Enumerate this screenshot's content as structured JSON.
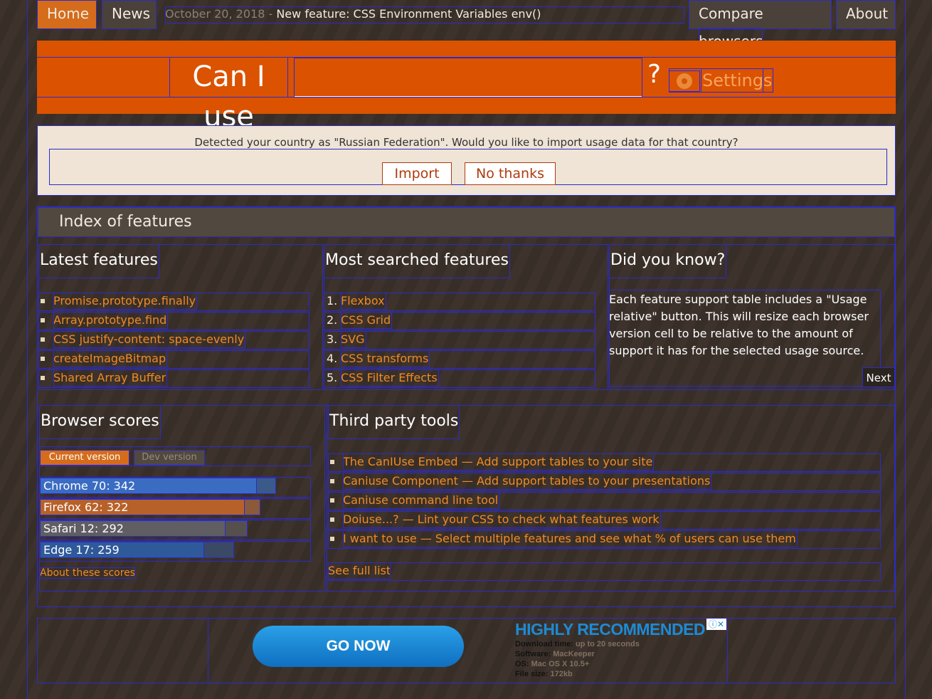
{
  "nav": {
    "home": "Home",
    "news": "News",
    "news_date": "October 20, 2018",
    "news_sep": " - ",
    "news_title": "New feature: CSS Environment Variables env()",
    "compare_word": "Compare",
    "browsers_word": "browsers",
    "about": "About"
  },
  "hero": {
    "title": "Can I use",
    "search_value": "",
    "question": "?",
    "settings_label": "Settings",
    "settings_icon": "gear-icon"
  },
  "notice": {
    "text": "Detected your country as \"Russian Federation\". Would you like to import usage data for that country?",
    "import_label": "Import",
    "no_thanks_label": "No thanks"
  },
  "index": {
    "title": "Index of features",
    "latest": {
      "heading": "Latest features",
      "items": [
        "Promise.prototype.finally",
        "Array.prototype.find",
        "CSS justify-content: space-evenly",
        "createImageBitmap",
        "Shared Array Buffer"
      ]
    },
    "most_searched": {
      "heading": "Most searched features",
      "items": [
        {
          "n": "1.",
          "label": "Flexbox"
        },
        {
          "n": "2.",
          "label": "CSS Grid"
        },
        {
          "n": "3.",
          "label": "SVG"
        },
        {
          "n": "4.",
          "label": "CSS transforms"
        },
        {
          "n": "5.",
          "label": "CSS Filter Effects"
        }
      ]
    },
    "did_you_know": {
      "heading": "Did you know?",
      "text": "Each feature support table includes a \"Usage relative\" button. This will resize each browser version cell to be relative to the amount of support it has for the selected usage source.",
      "next_label": "Next"
    },
    "browser_scores": {
      "heading": "Browser scores",
      "tab_current": "Current version",
      "tab_dev": "Dev version",
      "max_score": 400,
      "scores": [
        {
          "label": "Chrome 70: 342",
          "value": 342,
          "dev": 372,
          "color": "#3a6cc2",
          "color_dev": "#3a5a8a"
        },
        {
          "label": "Firefox 62: 322",
          "value": 322,
          "dev": 347,
          "color": "#b7612a",
          "color_dev": "#8a5a3a"
        },
        {
          "label": "Safari 12: 292",
          "value": 292,
          "dev": 327,
          "color": "#5e5e63",
          "color_dev": "#55504d"
        },
        {
          "label": "Edge 17: 259",
          "value": 259,
          "dev": 306,
          "color": "#2f5a9a",
          "color_dev": "#3a4a64"
        }
      ],
      "about_label": "About these scores"
    },
    "third_party": {
      "heading": "Third party tools",
      "items": [
        "The CanIUse Embed — Add support tables to your site",
        "Caniuse Component — Add support tables to your presentations",
        "Caniuse command line tool",
        "Doiuse...? — Lint your CSS to check what features work",
        "I want to use — Select multiple features and see what % of users can use them"
      ],
      "see_full_label": "See full list"
    }
  },
  "ad": {
    "button_label": "GO NOW",
    "headline": "HIGHLY RECOMMENDED",
    "rows": [
      {
        "k": "Download time:",
        "v": "up to 20 seconds"
      },
      {
        "k": "Software:",
        "v": "MacKeeper"
      },
      {
        "k": "OS:",
        "v": "Mac OS X 10.5+"
      },
      {
        "k": "File size:",
        "v": "172kb"
      }
    ],
    "close_icon": "close-icon",
    "info_icon": "info-icon"
  },
  "colors": {
    "accent": "#d56c1b",
    "hero_bg": "#db5200",
    "link": "#f08a24",
    "page_bg": "#3a3029"
  }
}
